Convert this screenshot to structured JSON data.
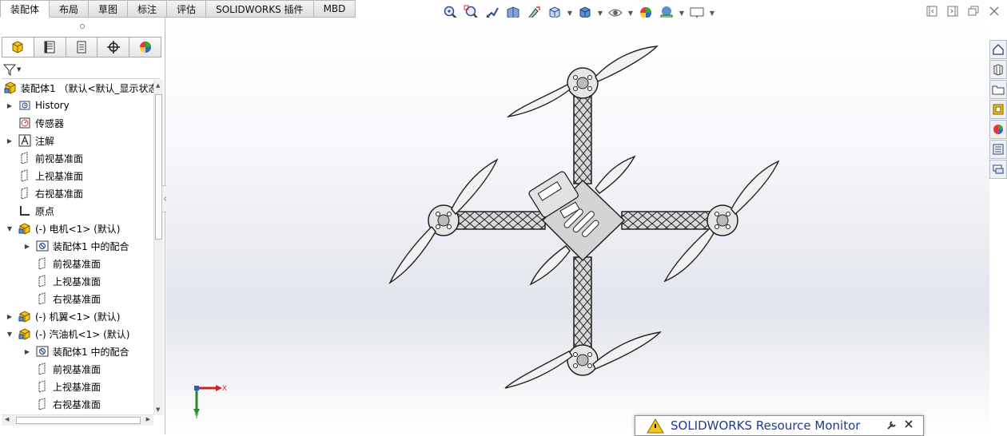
{
  "tabs": [
    "装配体",
    "布局",
    "草图",
    "标注",
    "评估",
    "SOLIDWORKS 插件",
    "MBD"
  ],
  "active_tab_index": 0,
  "hud_icons": [
    "zoom-to-fit-icon",
    "zoom-area-icon",
    "previous-view-icon",
    "section-view-icon",
    "dynamic-annotation-icon",
    "view-orientation-icon",
    "display-style-icon",
    "hide-show-icon",
    "edit-appearance-icon",
    "apply-scene-icon",
    "view-settings-icon"
  ],
  "pane_tabs": [
    "featuremanager-icon",
    "propertymanager-icon",
    "configurationmanager-icon",
    "dimxpert-icon",
    "displaymanager-icon"
  ],
  "tree": {
    "root": "装配体1 （默认<默认_显示状态",
    "items": [
      {
        "label": "History",
        "icon": "history-icon",
        "arrow": "right",
        "indent": 0
      },
      {
        "label": "传感器",
        "icon": "sensor-icon",
        "arrow": "",
        "indent": 0
      },
      {
        "label": "注解",
        "icon": "annotation-icon",
        "arrow": "right",
        "indent": 0
      },
      {
        "label": "前视基准面",
        "icon": "plane-icon",
        "arrow": "",
        "indent": 0
      },
      {
        "label": "上视基准面",
        "icon": "plane-icon",
        "arrow": "",
        "indent": 0
      },
      {
        "label": "右视基准面",
        "icon": "plane-icon",
        "arrow": "",
        "indent": 0
      },
      {
        "label": "原点",
        "icon": "origin-icon",
        "arrow": "",
        "indent": 0
      },
      {
        "label": "(-) 电机<1> (默认)",
        "icon": "part-icon",
        "arrow": "down",
        "indent": 0
      },
      {
        "label": "装配体1 中的配合",
        "icon": "mates-icon",
        "arrow": "right",
        "indent": 1
      },
      {
        "label": "前视基准面",
        "icon": "plane-icon",
        "arrow": "",
        "indent": 1
      },
      {
        "label": "上视基准面",
        "icon": "plane-icon",
        "arrow": "",
        "indent": 1
      },
      {
        "label": "右视基准面",
        "icon": "plane-icon",
        "arrow": "",
        "indent": 1
      },
      {
        "label": "(-) 机翼<1> (默认)",
        "icon": "part-icon",
        "arrow": "right",
        "indent": 0
      },
      {
        "label": "(-) 汽油机<1> (默认)",
        "icon": "part-icon",
        "arrow": "down",
        "indent": 0
      },
      {
        "label": "装配体1 中的配合",
        "icon": "mates-icon",
        "arrow": "right",
        "indent": 1
      },
      {
        "label": "前视基准面",
        "icon": "plane-icon",
        "arrow": "",
        "indent": 1
      },
      {
        "label": "上视基准面",
        "icon": "plane-icon",
        "arrow": "",
        "indent": 1
      },
      {
        "label": "右视基准面",
        "icon": "plane-icon",
        "arrow": "",
        "indent": 1
      }
    ]
  },
  "triad": {
    "x": "X",
    "y": "Y"
  },
  "task_pane_icons": [
    "home-icon",
    "design-library-icon",
    "file-explorer-icon",
    "view-palette-icon",
    "appearances-icon",
    "custom-properties-icon",
    "forum-icon"
  ],
  "resource_monitor": {
    "title": "SOLIDWORKS Resource Monitor"
  },
  "colors": {
    "accent": "#1b3c8f",
    "warning": "#f5c518"
  }
}
